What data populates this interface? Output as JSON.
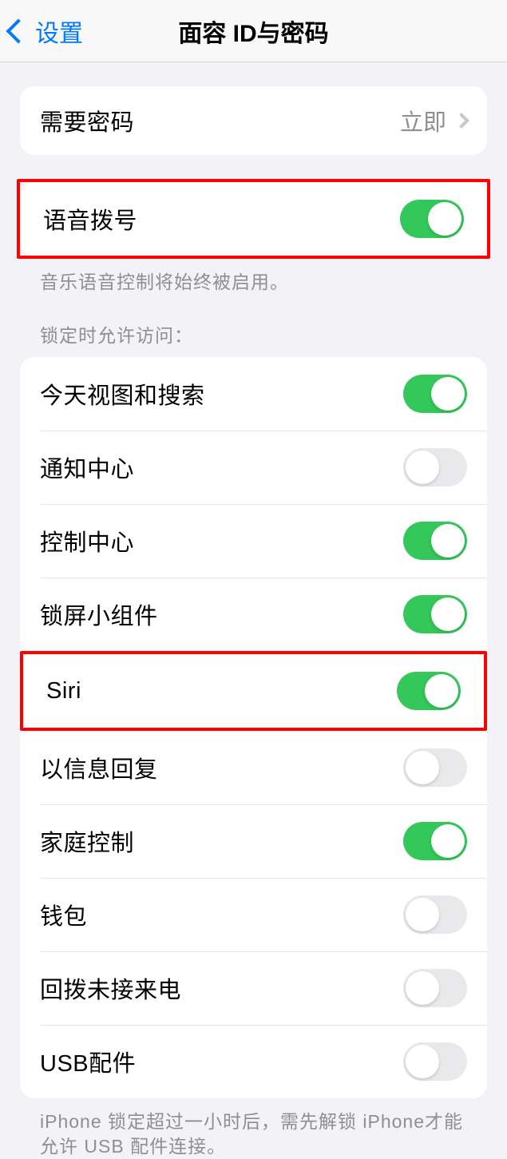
{
  "nav": {
    "back_label": "设置",
    "title": "面容 ID与密码"
  },
  "passcode_row": {
    "label": "需要密码",
    "value": "立即"
  },
  "voice_dial": {
    "label": "语音拨号",
    "on": true,
    "footer": "音乐语音控制将始终被启用。"
  },
  "lock_access": {
    "header": "锁定时允许访问：",
    "items": [
      {
        "label": "今天视图和搜索",
        "on": true
      },
      {
        "label": "通知中心",
        "on": false
      },
      {
        "label": "控制中心",
        "on": true
      },
      {
        "label": "锁屏小组件",
        "on": true
      },
      {
        "label": "Siri",
        "on": true,
        "highlighted": true
      },
      {
        "label": "以信息回复",
        "on": false
      },
      {
        "label": "家庭控制",
        "on": true
      },
      {
        "label": "钱包",
        "on": false
      },
      {
        "label": "回拨未接来电",
        "on": false
      },
      {
        "label": "USB配件",
        "on": false
      }
    ],
    "footer": "iPhone 锁定超过一小时后，需先解锁 iPhone才能允许\nUSB 配件连接。"
  }
}
